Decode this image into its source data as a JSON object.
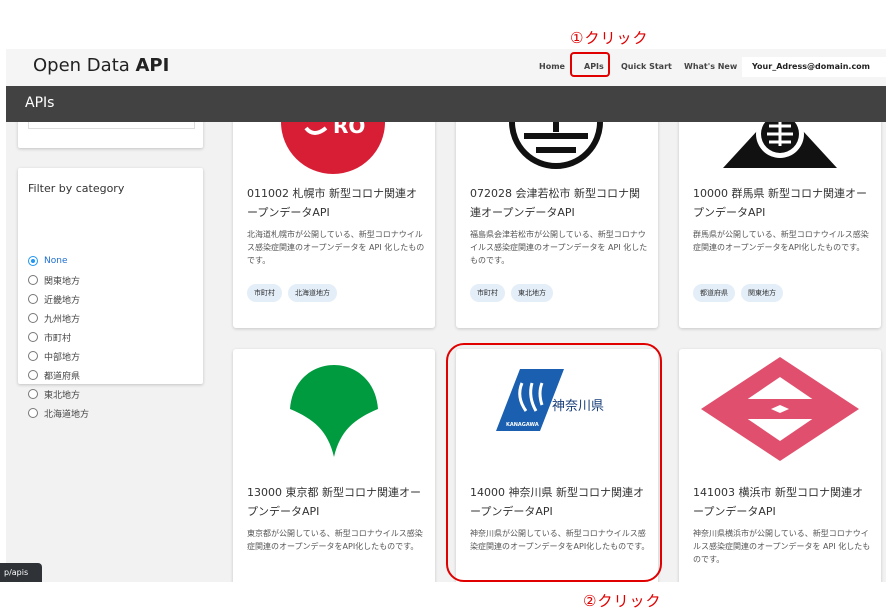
{
  "annotations": {
    "step1": "①クリック",
    "step2": "②クリック"
  },
  "header": {
    "brand_regular": "Open Data ",
    "brand_bold": "API",
    "nav": {
      "home": "Home",
      "apis": "APIs",
      "quick_start": "Quick Start",
      "whats_new": "What's New"
    },
    "user_email": "Your_Adress@domain.com"
  },
  "page_title": "APIs",
  "filter": {
    "title": "Filter by category",
    "options": [
      "None",
      "関東地方",
      "近畿地方",
      "九州地方",
      "市町村",
      "中部地方",
      "都道府県",
      "東北地方",
      "北海道地方"
    ],
    "selected": "None"
  },
  "cards": [
    {
      "title": "011002 札幌市 新型コロナ関連オープンデータAPI",
      "description": "北海道札幌市が公開している、新型コロナウイルス感染症関連のオープンデータを API 化したものです。",
      "tags": [
        "市町村",
        "北海道地方"
      ],
      "logo_text": "RO"
    },
    {
      "title": "072028 会津若松市 新型コロナ関連オープンデータAPI",
      "description": "福島県会津若松市が公開している、新型コロナウイルス感染症関連のオープンデータを API 化したものです。",
      "tags": [
        "市町村",
        "東北地方"
      ]
    },
    {
      "title": "10000 群馬県 新型コロナ関連オープンデータAPI",
      "description": "群馬県が公開している、新型コロナウイルス感染症関連のオープンデータをAPI化したものです。",
      "tags": [
        "都道府県",
        "関東地方"
      ]
    },
    {
      "title": "13000 東京都 新型コロナ関連オープンデータAPI",
      "description": "東京都が公開している、新型コロナウイルス感染症関連のオープンデータをAPI化したものです。",
      "tags": []
    },
    {
      "title": "14000 神奈川県 新型コロナ関連オープンデータAPI",
      "description": "神奈川県が公開している、新型コロナウイルス感染症関連のオープンデータをAPI化したものです。",
      "tags": [],
      "logo_text": "神奈川県",
      "logo_subtext": "KANAGAWA"
    },
    {
      "title": "141003 横浜市 新型コロナ関連オープンデータAPI",
      "description": "神奈川県横浜市が公開している、新型コロナウイルス感染症関連のオープンデータを API 化したものです。",
      "tags": []
    }
  ],
  "status_url": "p/apis",
  "colors": {
    "highlight": "#e00000",
    "header_dark": "#424242",
    "radio_accent": "#2196f3",
    "tokyo_green": "#009b3f",
    "yokohama_pink": "#e0506e",
    "sapporo_red": "#d81e35"
  }
}
